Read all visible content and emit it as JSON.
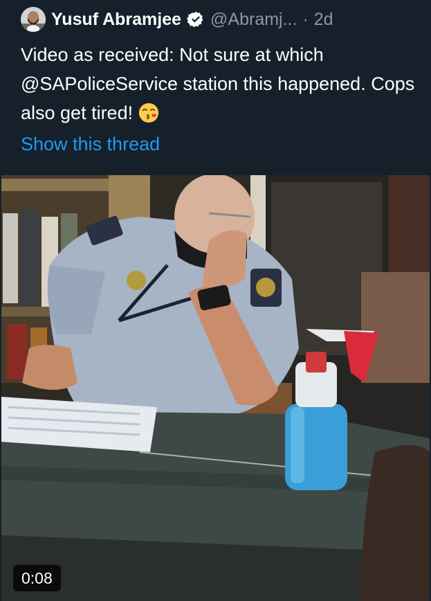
{
  "tweet": {
    "author_name": "Yusuf Abramjee",
    "handle": "@Abramj...",
    "separator": "·",
    "time": "2d",
    "text": "Video as received: Not sure at which @SAPoliceService station this happened. Cops also get tired!",
    "emoji": "kissing-face-icon",
    "thread_link": "Show this thread"
  },
  "media": {
    "type": "video",
    "duration": "0:08"
  },
  "colors": {
    "background": "#15202b",
    "link": "#1d9bf0",
    "secondary_text": "#8b98a5",
    "verified": "#ffffff"
  }
}
